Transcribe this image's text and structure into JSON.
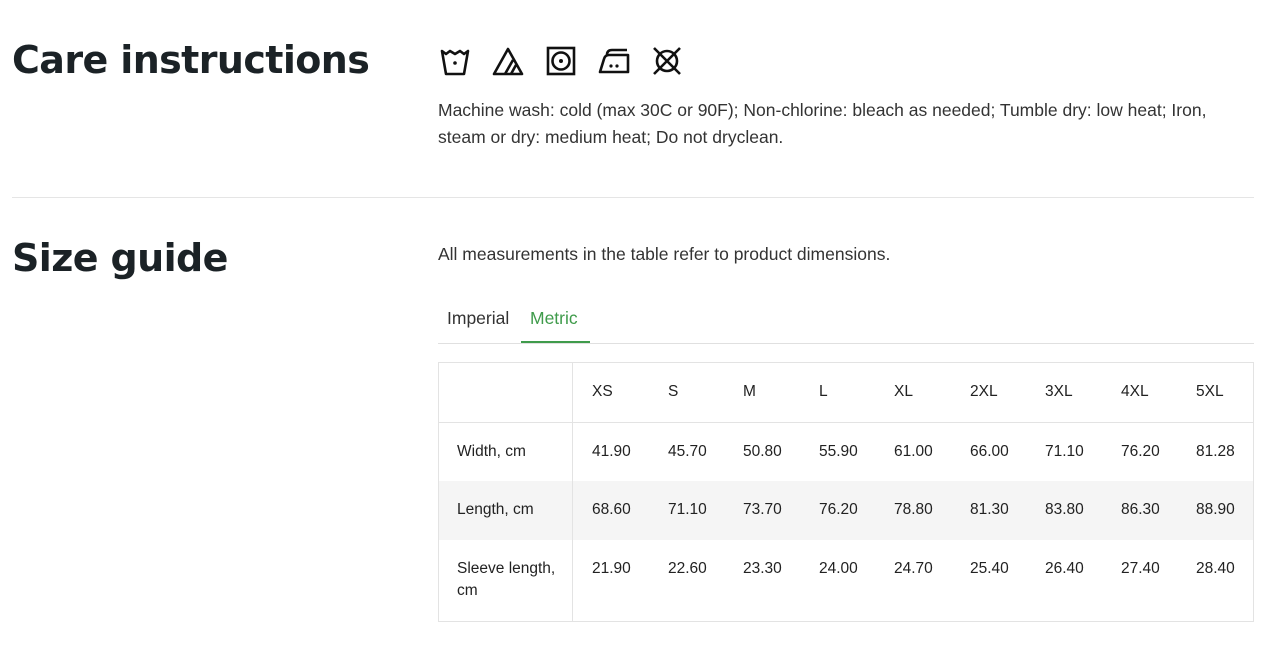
{
  "care": {
    "title": "Care instructions",
    "icons": [
      "machine-wash-cold-icon",
      "non-chlorine-bleach-icon",
      "tumble-dry-low-icon",
      "iron-medium-icon",
      "do-not-dryclean-icon"
    ],
    "text": "Machine wash: cold (max 30C or 90F); Non-chlorine: bleach as needed; Tumble dry: low heat; Iron, steam or dry: medium heat; Do not dryclean."
  },
  "size": {
    "title": "Size guide",
    "intro": "All measurements in the table refer to product dimensions.",
    "tabs": [
      {
        "label": "Imperial"
      },
      {
        "label": "Metric"
      }
    ],
    "active_tab": "Metric",
    "accent_color": "#3f9b4b",
    "table": {
      "columns": [
        "XS",
        "S",
        "M",
        "L",
        "XL",
        "2XL",
        "3XL",
        "4XL",
        "5XL"
      ],
      "rows": [
        {
          "label": "Width, cm",
          "values": [
            "41.90",
            "45.70",
            "50.80",
            "55.90",
            "61.00",
            "66.00",
            "71.10",
            "76.20",
            "81.28"
          ]
        },
        {
          "label": "Length, cm",
          "values": [
            "68.60",
            "71.10",
            "73.70",
            "76.20",
            "78.80",
            "81.30",
            "83.80",
            "86.30",
            "88.90"
          ]
        },
        {
          "label": "Sleeve length, cm",
          "values": [
            "21.90",
            "22.60",
            "23.30",
            "24.00",
            "24.70",
            "25.40",
            "26.40",
            "27.40",
            "28.40"
          ]
        }
      ]
    }
  }
}
